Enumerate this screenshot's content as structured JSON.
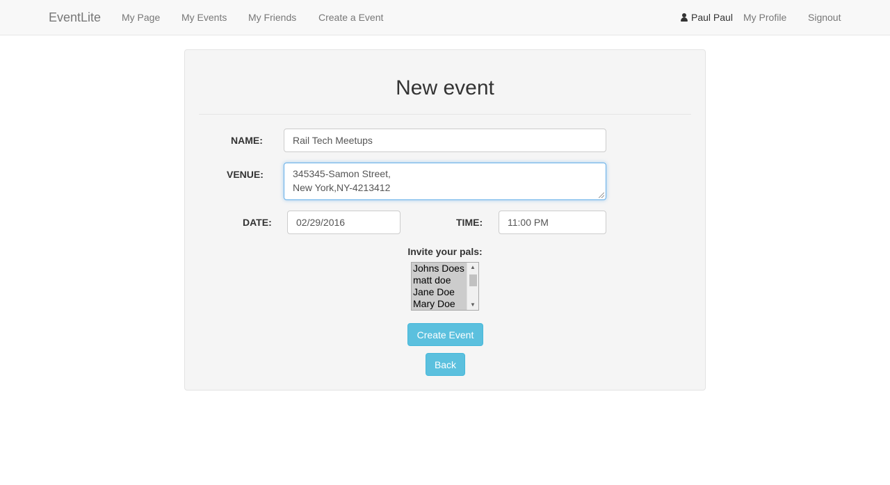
{
  "navbar": {
    "brand": "EventLite",
    "links": [
      "My Page",
      "My Events",
      "My Friends",
      "Create a Event"
    ],
    "user_name": "Paul Paul",
    "profile_link": "My Profile",
    "signout_link": "Signout"
  },
  "form": {
    "title": "New event",
    "name_label": "NAME:",
    "name_value": "Rail Tech Meetups",
    "venue_label": "VENUE:",
    "venue_line1": "345345-Samon Street,",
    "venue_line2": "New York,NY-4213412",
    "date_label": "DATE:",
    "date_value": "02/29/2016",
    "time_label": "TIME:",
    "time_value": "11:00 PM",
    "invite_label": "Invite your pals:",
    "friends": [
      "Johns Does",
      "matt doe",
      "Jane Doe",
      "Mary Doe"
    ],
    "create_button": "Create Event",
    "back_button": "Back"
  },
  "colors": {
    "button": "#5bc0de",
    "focus_border": "#66afe9",
    "navbar_bg": "#f8f8f8",
    "panel_bg": "#f5f5f5"
  },
  "icons": {
    "user": "user-icon",
    "scroll_up": "scroll-up-arrow-icon",
    "scroll_down": "scroll-down-arrow-icon"
  }
}
